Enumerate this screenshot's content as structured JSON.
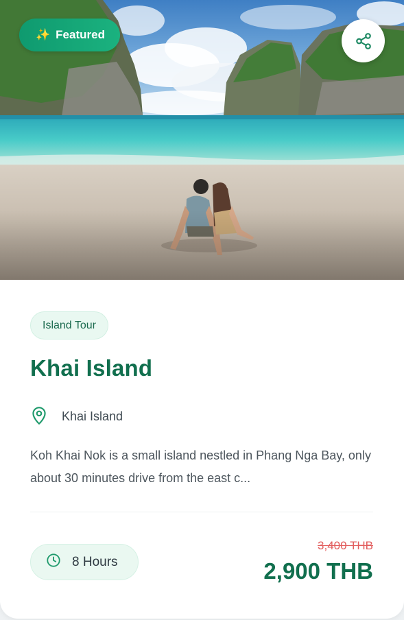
{
  "hero": {
    "featured_label": "Featured",
    "featured_icon": "sparkles-icon",
    "share_icon": "share-icon",
    "image_description": "couple-sitting-on-tropical-beach"
  },
  "tour": {
    "category": "Island Tour",
    "title": "Khai Island",
    "location": "Khai Island",
    "description": "Koh Khai Nok is a small island nestled in Phang Nga Bay, only about 30 minutes drive from the east c...",
    "duration": "8 Hours",
    "original_price": "3,400 THB",
    "price": "2,900 THB"
  },
  "colors": {
    "primary": "#116f4e",
    "accent": "#1bb27f",
    "strike_price": "#e25c5c",
    "pill_bg": "#e9f8f1"
  }
}
